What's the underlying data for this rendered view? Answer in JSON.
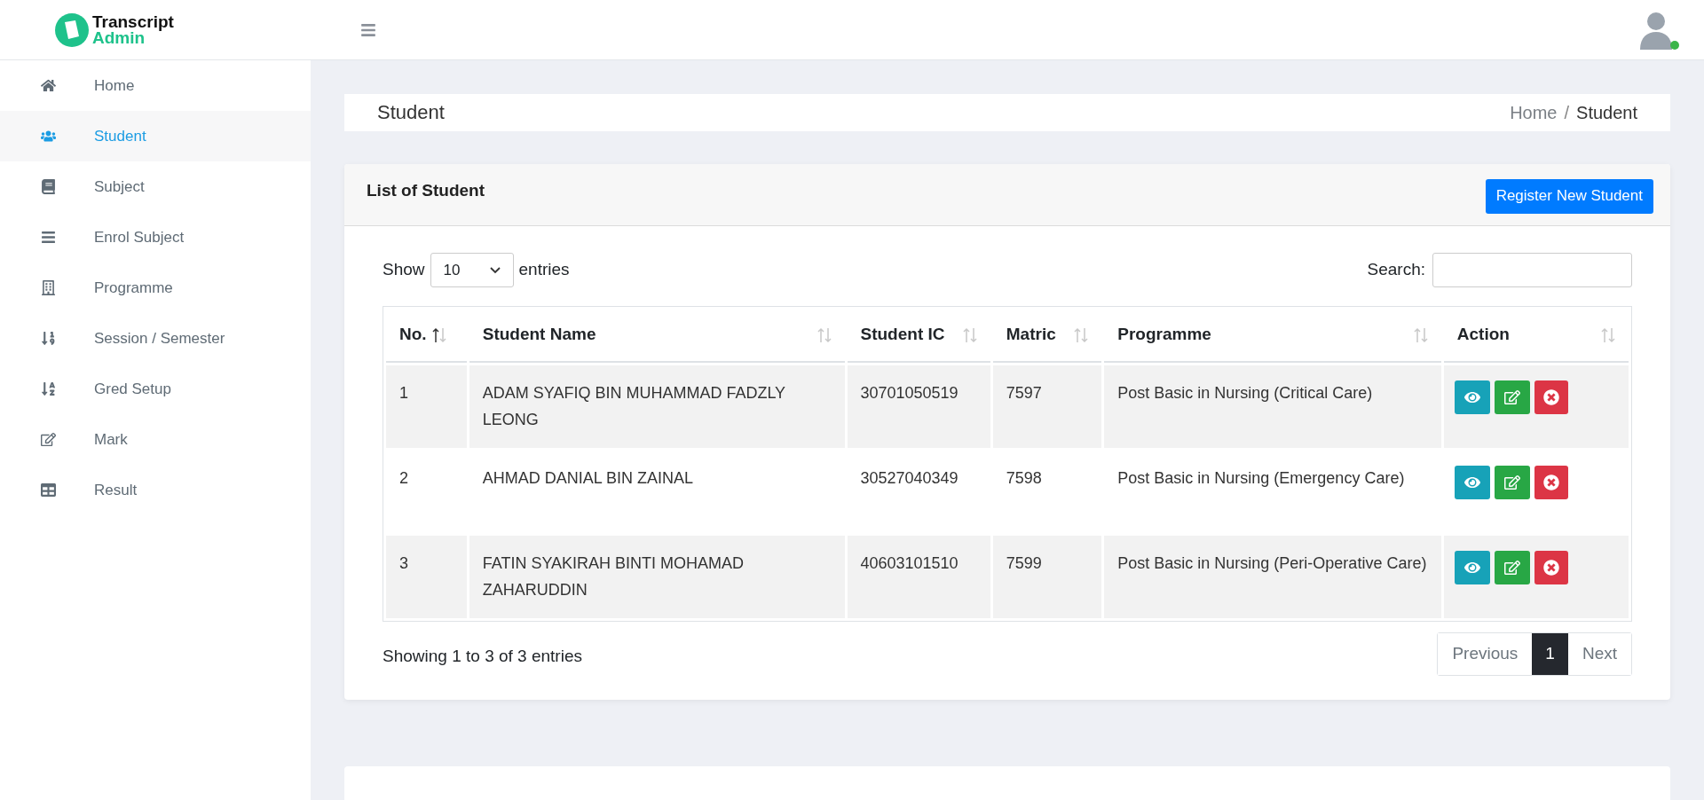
{
  "brand": {
    "line1": "Transcript",
    "line2": "Admin"
  },
  "user": {
    "online": true
  },
  "sidebar": {
    "items": [
      {
        "label": "Home",
        "selected": false
      },
      {
        "label": "Student",
        "selected": true
      },
      {
        "label": "Subject",
        "selected": false
      },
      {
        "label": "Enrol Subject",
        "selected": false
      },
      {
        "label": "Programme",
        "selected": false
      },
      {
        "label": "Session / Semester",
        "selected": false
      },
      {
        "label": "Gred Setup",
        "selected": false
      },
      {
        "label": "Mark",
        "selected": false
      },
      {
        "label": "Result",
        "selected": false
      }
    ]
  },
  "page": {
    "title": "Student",
    "breadcrumb": [
      "Home",
      "Student"
    ],
    "separator": "/"
  },
  "card": {
    "title": "List of Student",
    "action": "Register New Student",
    "length": {
      "prefix": "Show",
      "value": "10",
      "suffix": "entries"
    },
    "search": {
      "label": "Search:"
    },
    "table": {
      "columns": [
        {
          "label": "No.",
          "sorted": true
        },
        {
          "label": "Student Name",
          "sorted": false
        },
        {
          "label": "Student IC",
          "sorted": false
        },
        {
          "label": "Matric",
          "sorted": false
        },
        {
          "label": "Programme",
          "sorted": false
        },
        {
          "label": "Action",
          "sorted": false
        }
      ],
      "rows": [
        {
          "cells": [
            "1",
            "ADAM SYAFIQ BIN MUHAMMAD FADZLY LEONG",
            "30701050519",
            "7597",
            "Post Basic in Nursing (Critical Care)"
          ]
        },
        {
          "cells": [
            "2",
            "AHMAD DANIAL BIN ZAINAL",
            "30527040349",
            "7598",
            "Post Basic in Nursing (Emergency Care)"
          ]
        },
        {
          "cells": [
            "3",
            "FATIN SYAKIRAH BINTI MOHAMAD ZAHARUDDIN",
            "40603101510",
            "7599",
            "Post Basic in Nursing (Peri-Operative Care)"
          ]
        }
      ]
    },
    "info": "Showing 1 to 3 of 3 entries",
    "pagination": [
      {
        "label": "Previous",
        "kind": "nav",
        "selected": false
      },
      {
        "label": "1",
        "kind": "page",
        "selected": true
      },
      {
        "label": "Next",
        "kind": "nav",
        "selected": false
      }
    ]
  }
}
